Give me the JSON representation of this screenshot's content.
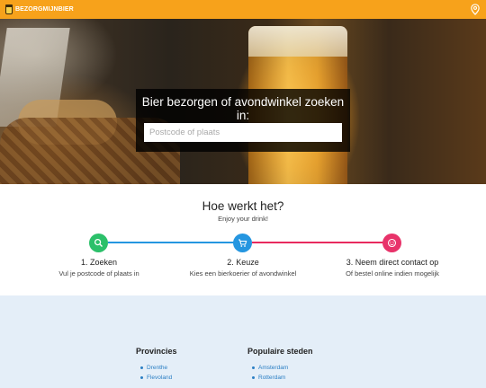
{
  "header": {
    "logo_text": "BEZORGMIJNBIER",
    "location_icon": "map-pin-icon",
    "background_color": "#f7a21b"
  },
  "hero": {
    "title": "Bier bezorgen of avondwinkel zoeken in:",
    "search_placeholder": "Postcode of plaats"
  },
  "how": {
    "title": "Hoe werkt het?",
    "subtitle": "Enjoy your drink!",
    "steps": [
      {
        "title": "1. Zoeken",
        "description": "Vul je postcode of plaats in",
        "icon": "search-icon",
        "color": "#2cc06a"
      },
      {
        "title": "2. Keuze",
        "description": "Kies een bierkoerier of avondwinkel",
        "icon": "cart-icon",
        "color": "#2596e0"
      },
      {
        "title": "3. Neem direct contact op",
        "description": "Of bestel online indien mogelijk",
        "icon": "smiley-icon",
        "color": "#e8336a"
      }
    ]
  },
  "footer": {
    "provinces_title": "Provincies",
    "provinces": [
      "Drenthe",
      "Flevoland"
    ],
    "cities_title": "Populaire steden",
    "cities": [
      "Amsterdam",
      "Rotterdam"
    ]
  }
}
